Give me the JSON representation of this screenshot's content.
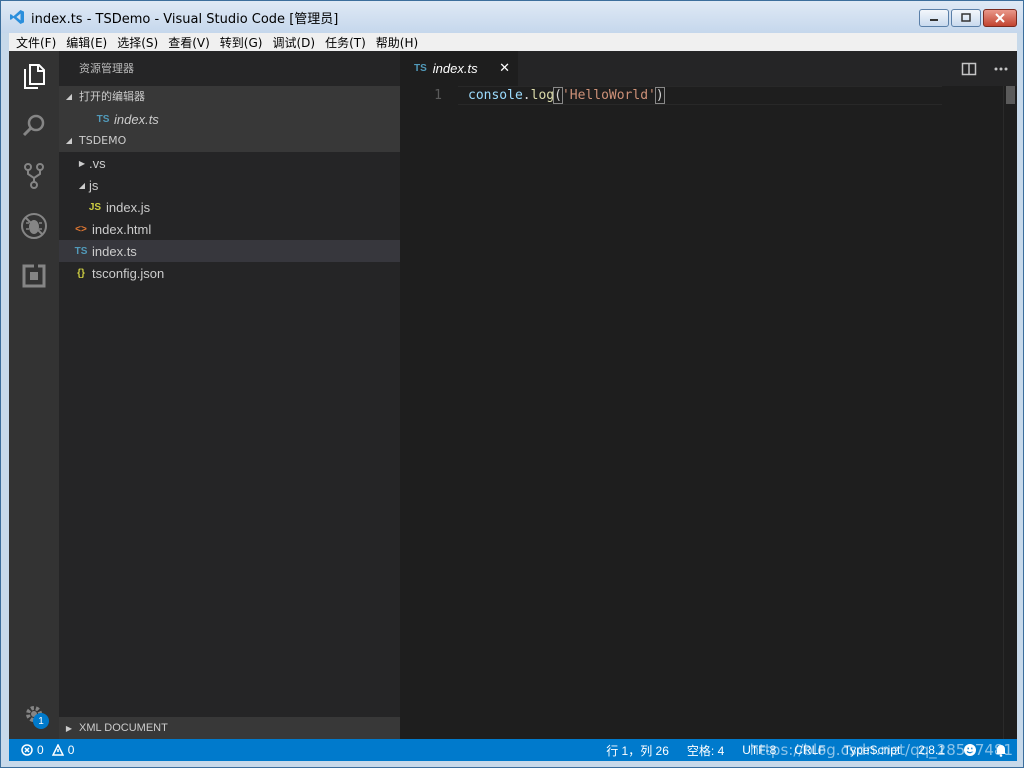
{
  "window": {
    "title": "index.ts - TSDemo - Visual Studio Code [管理员]"
  },
  "menu": [
    "文件(F)",
    "编辑(E)",
    "选择(S)",
    "查看(V)",
    "转到(G)",
    "调试(D)",
    "任务(T)",
    "帮助(H)"
  ],
  "sidebar": {
    "title": "资源管理器",
    "open_editors_label": "打开的编辑器",
    "open_editors": [
      {
        "icon": "TS",
        "label": "index.ts"
      }
    ],
    "project_label": "TSDEMO",
    "tree": [
      {
        "icon": "",
        "label": ".vs",
        "twist": "▶"
      },
      {
        "icon": "",
        "label": "js",
        "twist": "◢"
      },
      {
        "icon": "JS",
        "label": "index.js"
      },
      {
        "icon": "<>",
        "label": "index.html"
      },
      {
        "icon": "TS",
        "label": "index.ts"
      },
      {
        "icon": "{}",
        "label": "tsconfig.json"
      }
    ],
    "bottom_section": "XML DOCUMENT"
  },
  "activity": {
    "badge": "1"
  },
  "editor": {
    "tab": {
      "icon": "TS",
      "label": "index.ts",
      "close": "✕"
    },
    "line_number": "1",
    "code": {
      "ident": "console",
      "dot": ".",
      "fn": "log",
      "open": "(",
      "str": "'HelloWorld'",
      "close": ")"
    }
  },
  "status": {
    "errors": "0",
    "warnings": "0",
    "position": "行 1，列 26",
    "spaces": "空格: 4",
    "encoding": "UTF-8",
    "eol": "CRLF",
    "language": "TypeScript",
    "version": "2.8.1",
    "watermark": "https://blog.csdn.net/qq_28597481"
  },
  "colors": {
    "accent": "#007acc",
    "sidebar": "#252526",
    "editor": "#1e1e1e",
    "activity": "#333333"
  }
}
